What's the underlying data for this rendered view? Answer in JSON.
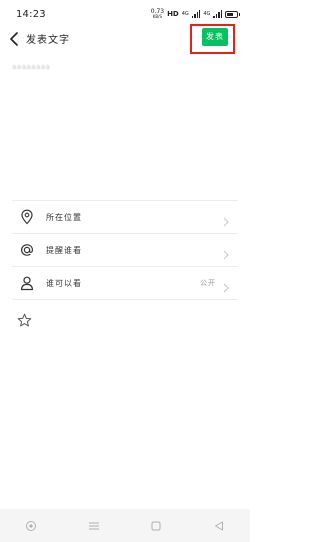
{
  "status_bar": {
    "time": "14:23",
    "net_speed_value": "0.73",
    "net_speed_unit": "KB/S",
    "hd_label": "HD",
    "signal_tag_1": "4G",
    "signal_tag_2": "4G"
  },
  "header": {
    "title": "发表文字",
    "publish_label": "发表"
  },
  "composer": {
    "text": "aaaaaaaa"
  },
  "options": [
    {
      "label": "所在位置",
      "value": ""
    },
    {
      "label": "提醒谁看",
      "value": ""
    },
    {
      "label": "谁可以看",
      "value": "公开"
    }
  ],
  "colors": {
    "accent": "#07c160",
    "highlight": "#e2231a"
  },
  "icons": {
    "back": "back-arrow-icon",
    "location": "location-pin-icon",
    "mention": "at-icon",
    "visibility": "person-icon",
    "favorite": "star-icon"
  }
}
